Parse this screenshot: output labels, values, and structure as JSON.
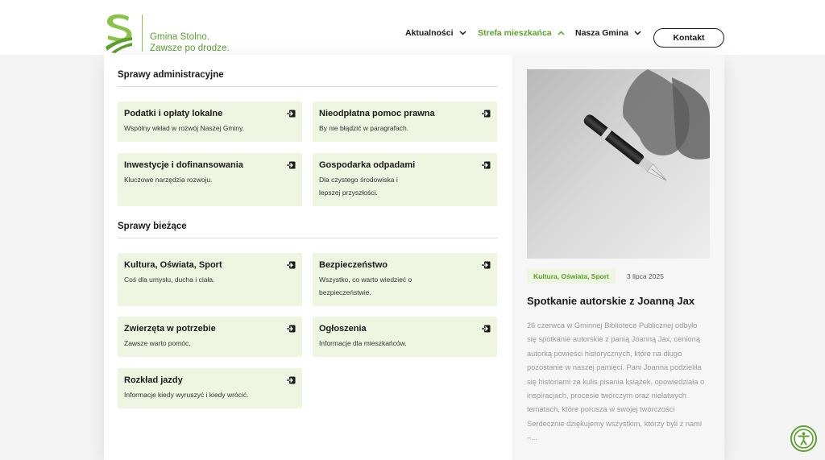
{
  "brand": {
    "line1": "Gmina Stolno.",
    "line2": "Zawsze po drodze."
  },
  "nav": {
    "aktualnosci": "Aktualności",
    "strefa": "Strefa mieszkańca",
    "nasza": "Nasza Gmina",
    "kontakt": "Kontakt"
  },
  "sections": {
    "administracyjne": "Sprawy administracyjne",
    "biezace": "Sprawy bieżące"
  },
  "cards": [
    {
      "title": "Podatki i opłaty lokalne",
      "desc": "Wspólny wkład w rozwój Naszej Gminy."
    },
    {
      "title": "Nieodpłatna pomoc prawna",
      "desc": "By nie błądzić w paragrafach."
    },
    {
      "title": "Inwestycje i dofinansowania",
      "desc": "Kluczowe narzędzia rozwoju."
    },
    {
      "title": "Gospodarka odpadami",
      "desc": "Dla czystego środowiska i lepszej przyszłości."
    },
    {
      "title": "Kultura, Oświata, Sport",
      "desc": "Coś dla umysłu, ducha i ciała."
    },
    {
      "title": "Bezpieczeństwo",
      "desc": "Wszystko, co warto wiedzieć o bezpieczeństwie."
    },
    {
      "title": "Zwierzęta w potrzebie",
      "desc": "Zawsze warto pomóc."
    },
    {
      "title": "Ogłoszenia",
      "desc": "Informacje dla mieszkańców."
    },
    {
      "title": "Rozkład jazdy",
      "desc": "Informacje kiedy wyruszyć i kiedy wrócić."
    }
  ],
  "article": {
    "tag": "Kultura, Oświata, Sport",
    "date": "3 lipca 2025",
    "title": "Spotkanie autorskie z Joanną Jax",
    "excerpt": "26 czerwca w Gminnej Bibliotece Publicznej odbyło się spotkanie autorskie z panią Joanną Jax, cenioną autorką powieści historycznych, które na długo pozostanie w naszej pamięci. Pani Joanna podzieliła się historiami za kulis pisania książek, opowiedziała o inspiracjach, procesie twórczym oraz niełatwych tematach, które porusza w swojej twórczości Serdecznie dziękujemy wszystkim, którzy byli z nami –..."
  },
  "icons": {
    "menu_arrow": "arrow-right-box-icon",
    "chevron": "chevron-down-icon",
    "accessibility": "accessibility-icon"
  },
  "colors": {
    "brand_green": "#5aa02c",
    "card_bg": "#eef5e0"
  }
}
